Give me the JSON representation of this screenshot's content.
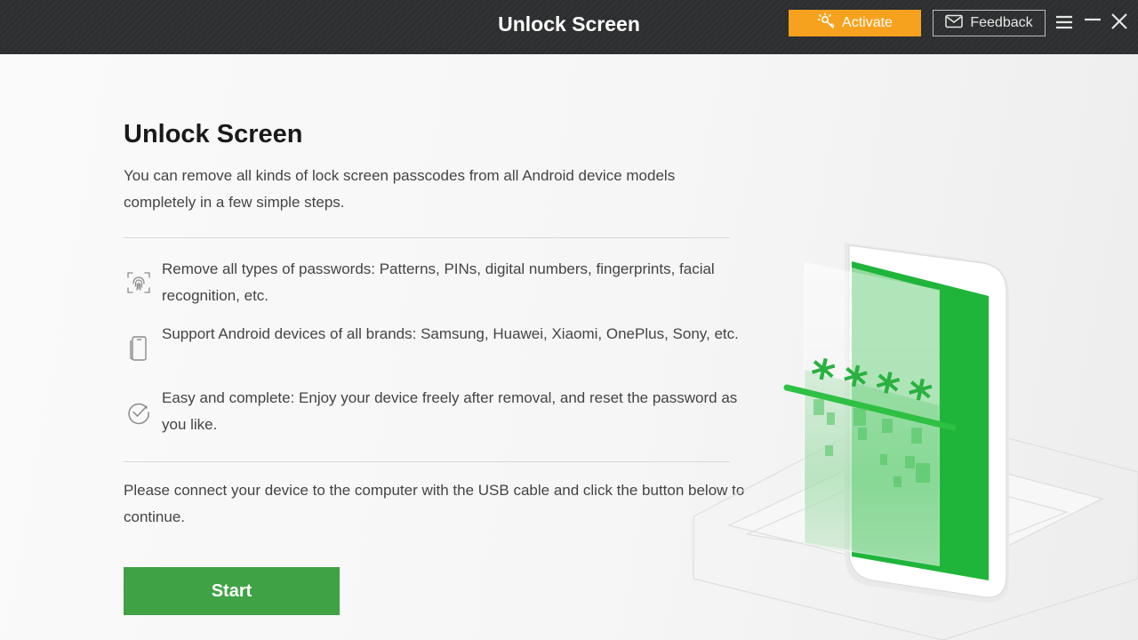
{
  "titlebar": {
    "title": "Unlock Screen",
    "activate_label": "Activate",
    "feedback_label": "Feedback"
  },
  "main": {
    "title": "Unlock Screen",
    "intro": "You can remove all kinds of lock screen passcodes from all Android device models completely in a few simple steps.",
    "features": [
      {
        "icon": "fingerprint-icon",
        "text": "Remove all types of passwords: Patterns, PINs, digital numbers, fingerprints, facial recognition, etc."
      },
      {
        "icon": "phone-icon",
        "text": "Support Android devices of all brands: Samsung, Huawei, Xiaomi, OnePlus, Sony, etc."
      },
      {
        "icon": "check-circle-icon",
        "text": "Easy and complete: Enjoy your device freely after removal, and reset the password as you like."
      }
    ],
    "connect_text": "Please connect your device to the computer with the USB cable and click the button below to continue.",
    "start_label": "Start",
    "illustration_text": "****"
  },
  "colors": {
    "titlebar_bg": "#2d2e2f",
    "activate_bg": "#f7a21e",
    "start_bg": "#3fa244",
    "accent_green": "#22b83a"
  }
}
